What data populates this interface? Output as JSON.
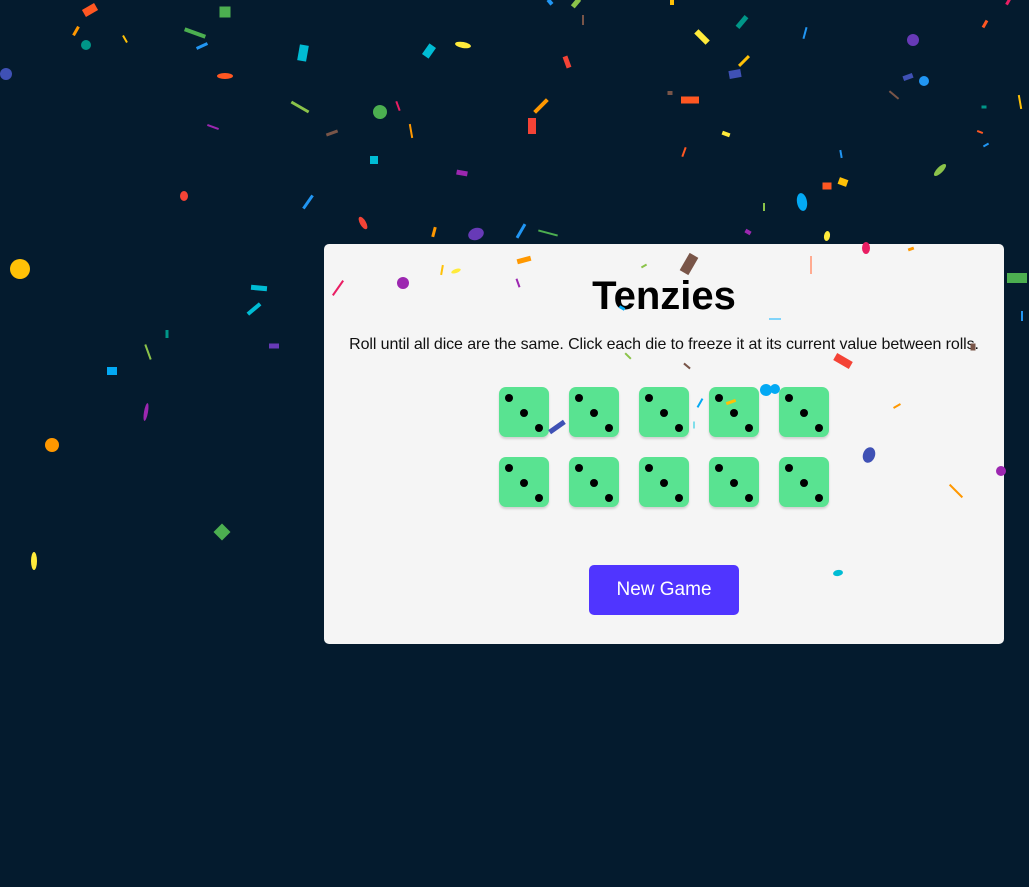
{
  "app": {
    "title": "Tenzies",
    "instructions": "Roll until all dice are the same. Click each die to freeze it at its current value between rolls."
  },
  "dice": [
    {
      "value": 3,
      "held": false
    },
    {
      "value": 3,
      "held": false
    },
    {
      "value": 3,
      "held": false
    },
    {
      "value": 3,
      "held": false
    },
    {
      "value": 3,
      "held": false
    },
    {
      "value": 3,
      "held": false
    },
    {
      "value": 3,
      "held": false
    },
    {
      "value": 3,
      "held": false
    },
    {
      "value": 3,
      "held": false
    },
    {
      "value": 3,
      "held": false
    }
  ],
  "controls": {
    "new_game_label": "New Game"
  },
  "colors": {
    "background": "#041b2e",
    "card": "#f5f5f5",
    "die_face": "#59e391",
    "pip": "#000000",
    "button": "#5035ff",
    "button_text": "#ffffff"
  },
  "status": {
    "won": true,
    "confetti_visible": true
  }
}
